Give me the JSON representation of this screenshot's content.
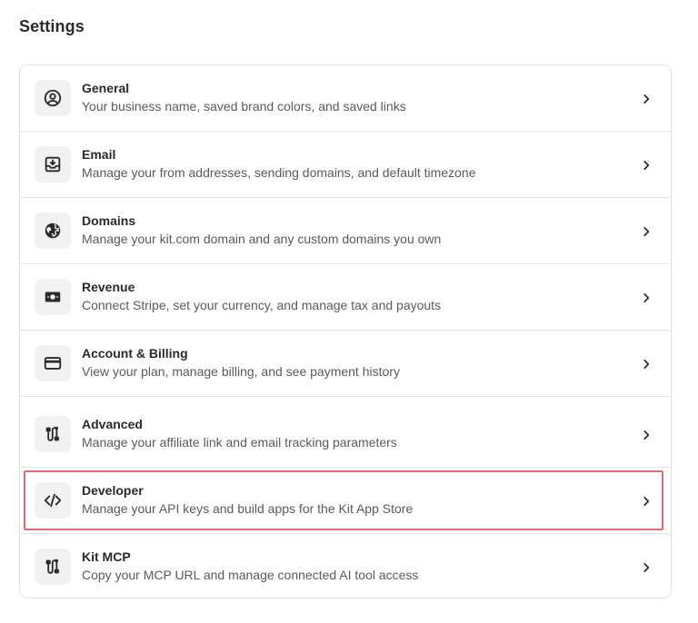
{
  "page": {
    "title": "Settings"
  },
  "items": [
    {
      "key": "general",
      "icon": "user-circle-icon",
      "title": "General",
      "description": "Your business name, saved brand colors, and saved links"
    },
    {
      "key": "email",
      "icon": "inbox-download-icon",
      "title": "Email",
      "description": "Manage your from addresses, sending domains, and default timezone"
    },
    {
      "key": "domains",
      "icon": "globe-icon",
      "title": "Domains",
      "description": "Manage your kit.com domain and any custom domains you own"
    },
    {
      "key": "revenue",
      "icon": "banknote-icon",
      "title": "Revenue",
      "description": "Connect Stripe, set your currency, and manage tax and payouts"
    },
    {
      "key": "account-billing",
      "icon": "credit-card-icon",
      "title": "Account & Billing",
      "description": "View your plan, manage billing, and see payment history"
    },
    {
      "key": "advanced",
      "icon": "plug-connector-icon",
      "title": "Advanced",
      "description": "Manage your affiliate link and email tracking parameters"
    },
    {
      "key": "developer",
      "icon": "code-brackets-icon",
      "title": "Developer",
      "description": "Manage your API keys and build apps for the Kit App Store"
    },
    {
      "key": "kit-mcp",
      "icon": "plug-connector-icon",
      "title": "Kit MCP",
      "description": "Copy your MCP URL and manage connected AI tool access"
    }
  ],
  "colors": {
    "highlight": "#e06a6f",
    "icon_bg": "#f1f1f1",
    "border": "#e3e3e3"
  }
}
